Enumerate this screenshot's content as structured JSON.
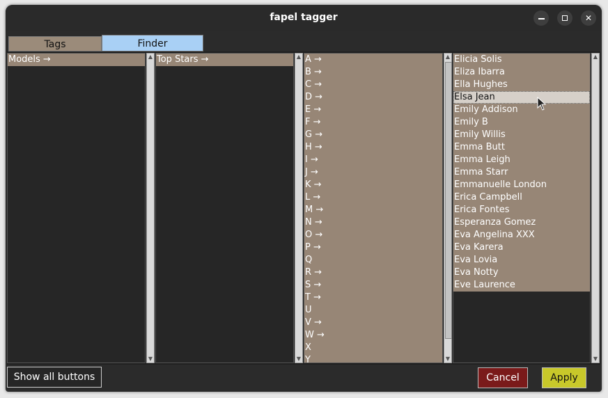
{
  "window": {
    "title": "fapel tagger"
  },
  "tabs": [
    {
      "label": "Tags"
    },
    {
      "label": "Finder"
    }
  ],
  "columns": {
    "models": {
      "header": "Models →"
    },
    "topstars": {
      "header": "Top Stars →"
    },
    "letters": [
      "A →",
      "B →",
      "C →",
      "D →",
      "E →",
      "F →",
      "G →",
      "H →",
      "I →",
      "J →",
      "K →",
      "L →",
      "M →",
      "N →",
      "O →",
      "P →",
      "Q",
      "R →",
      "S →",
      "T →",
      "U",
      "V →",
      "W →",
      "X",
      "Y"
    ],
    "names": [
      "Elicia Solis",
      "Eliza Ibarra",
      "Ella Hughes",
      "Elsa Jean",
      "Emily Addison",
      "Emily B",
      "Emily Willis",
      "Emma Butt",
      "Emma Leigh",
      "Emma Starr",
      "Emmanuelle London",
      "Erica Campbell",
      "Erica Fontes",
      "Esperanza Gomez",
      "Eva Angelina XXX",
      "Eva Karera",
      "Eva Lovia",
      "Eva Notty",
      "Eve Laurence"
    ],
    "selected_name": "Elsa Jean"
  },
  "buttons": {
    "show_all": "Show all buttons",
    "cancel": "Cancel",
    "apply": "Apply"
  },
  "colors": {
    "list_bg": "#978676",
    "finder_tab": "#a9d0f5",
    "cancel": "#7a1a1a",
    "apply": "#c8c82a"
  }
}
